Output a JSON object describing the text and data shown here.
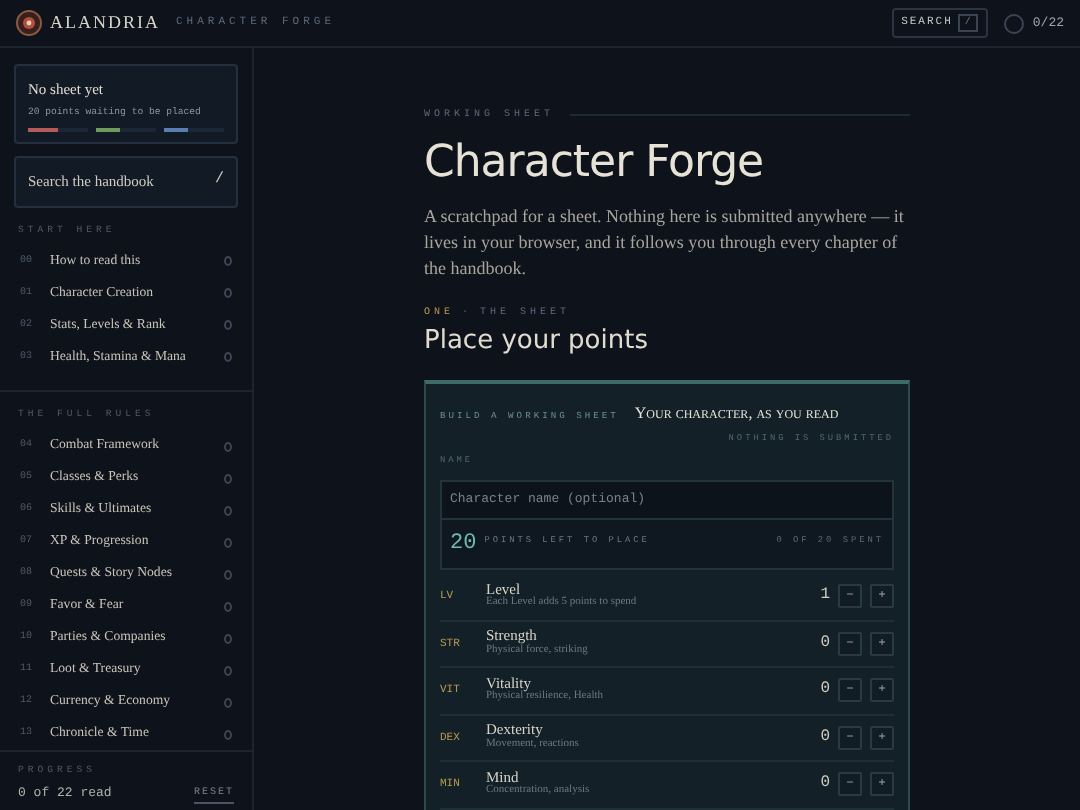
{
  "header": {
    "brand": "ALANDRIA",
    "subtitle": "CHARACTER FORGE",
    "search_button": "SEARCH",
    "search_key": "/",
    "progress": "0/22"
  },
  "sidebar": {
    "sheet_card": {
      "title": "No sheet yet",
      "note": "20 points waiting to be placed",
      "bars": [
        {
          "color": "#b45a5a",
          "level": 0.5
        },
        {
          "color": "#6e9a5e",
          "level": 0.4
        },
        {
          "color": "#5a7eb4",
          "level": 0.4
        }
      ]
    },
    "search": {
      "placeholder": "Search the handbook",
      "key": "/"
    },
    "sections": [
      {
        "title": "START HERE",
        "items": [
          {
            "number": "00",
            "label": "How to read this"
          },
          {
            "number": "01",
            "label": "Character Creation"
          },
          {
            "number": "02",
            "label": "Stats, Levels & Rank"
          },
          {
            "number": "03",
            "label": "Health, Stamina & Mana"
          }
        ]
      },
      {
        "title": "THE FULL RULES",
        "items": [
          {
            "number": "04",
            "label": "Combat Framework"
          },
          {
            "number": "05",
            "label": "Classes & Perks"
          },
          {
            "number": "06",
            "label": "Skills & Ultimates"
          },
          {
            "number": "07",
            "label": "XP & Progression"
          },
          {
            "number": "08",
            "label": "Quests & Story Nodes"
          },
          {
            "number": "09",
            "label": "Favor & Fear"
          },
          {
            "number": "10",
            "label": "Parties & Companies"
          },
          {
            "number": "11",
            "label": "Loot & Treasury"
          },
          {
            "number": "12",
            "label": "Currency & Economy"
          },
          {
            "number": "13",
            "label": "Chronicle & Time"
          }
        ]
      }
    ],
    "progress": {
      "label": "PROGRESS",
      "value": "0 of 22 read",
      "reset": "RESET"
    }
  },
  "main": {
    "eyebrow": "WORKING SHEET",
    "title": "Character Forge",
    "intro": "A scratchpad for a sheet. Nothing here is submitted anywhere — it lives in your browser, and it follows you through every chapter of the handbook.",
    "section_number": "ONE",
    "section_separator": "·",
    "section_label": "THE SHEET",
    "section_title": "Place your points",
    "sheet": {
      "kicker": "BUILD A WORKING SHEET",
      "title": "Your character, as you read",
      "note": "NOTHING IS SUBMITTED",
      "name_label": "NAME",
      "name_placeholder": "Character name (optional)",
      "points": "20",
      "points_label": "POINTS LEFT TO PLACE",
      "spent": "0 OF 20 SPENT",
      "stats": [
        {
          "abbr": "LV",
          "name": "Level",
          "hint": "Each Level adds 5 points to spend",
          "value": "1",
          "minus": "−",
          "plus": "+"
        },
        {
          "abbr": "STR",
          "name": "Strength",
          "hint": "Physical force, striking",
          "value": "0",
          "minus": "−",
          "plus": "+"
        },
        {
          "abbr": "VIT",
          "name": "Vitality",
          "hint": "Physical resilience, Health",
          "value": "0",
          "minus": "−",
          "plus": "+"
        },
        {
          "abbr": "DEX",
          "name": "Dexterity",
          "hint": "Movement, reactions",
          "value": "0",
          "minus": "−",
          "plus": "+"
        },
        {
          "abbr": "MIN",
          "name": "Mind",
          "hint": "Concentration, analysis",
          "value": "0",
          "minus": "−",
          "plus": "+"
        }
      ]
    }
  }
}
